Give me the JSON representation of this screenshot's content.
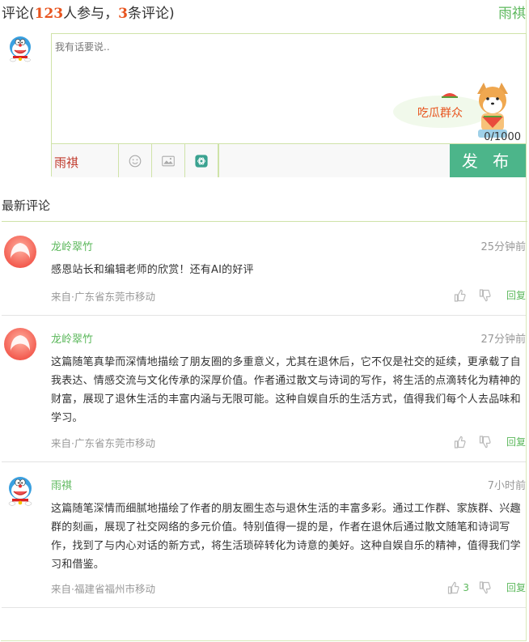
{
  "header": {
    "label_prefix": "评论(",
    "participants": "123",
    "participants_suffix": "人参与，",
    "comment_count": "3",
    "count_suffix": "条评论)",
    "current_user": "雨祺"
  },
  "editor": {
    "placeholder": "我有话要说..",
    "counter": "0/1000",
    "bar_user": "雨祺",
    "publish_label": "发 布",
    "mascot_text": "吃瓜群众"
  },
  "section": {
    "latest_title": "最新评论"
  },
  "comments": [
    {
      "author": "龙岭翠竹",
      "time": "25分钟前",
      "body": "感恩站长和编辑老师的欣赏！还有AI的好评",
      "source": "来自·广东省东莞市移动",
      "likes": "",
      "reply": "回复",
      "avatar": "red-blob-avatar"
    },
    {
      "author": "龙岭翠竹",
      "time": "27分钟前",
      "body": "这篇随笔真挚而深情地描绘了朋友圈的多重意义，尤其在退休后，它不仅是社交的延续，更承载了自我表达、情感交流与文化传承的深厚价值。作者通过散文与诗词的写作，将生活的点滴转化为精神的财富，展现了退休生活的丰富内涵与无限可能。这种自娱自乐的生活方式，值得我们每个人去品味和学习。",
      "source": "来自·广东省东莞市移动",
      "likes": "",
      "reply": "回复",
      "avatar": "red-blob-avatar"
    },
    {
      "author": "雨祺",
      "time": "7小时前",
      "body": "这篇随笔深情而细腻地描绘了作者的朋友圈生态与退休生活的丰富多彩。通过工作群、家族群、兴趣群的刻画，展现了社交网络的多元价值。特别值得一提的是，作者在退休后通过散文随笔和诗词写作，找到了与内心对话的新方式，将生活琐碎转化为诗意的美好。这种自娱自乐的精神，值得我们学习和借鉴。",
      "source": "来自·福建省福州市移动",
      "likes": "3",
      "reply": "回复",
      "avatar": "doraemon-avatar"
    }
  ],
  "colors": {
    "accent_green": "#5cb85c",
    "publish_bg": "#4cb58a",
    "number_orange": "#e8541e",
    "border_green": "#cfe3a8"
  }
}
